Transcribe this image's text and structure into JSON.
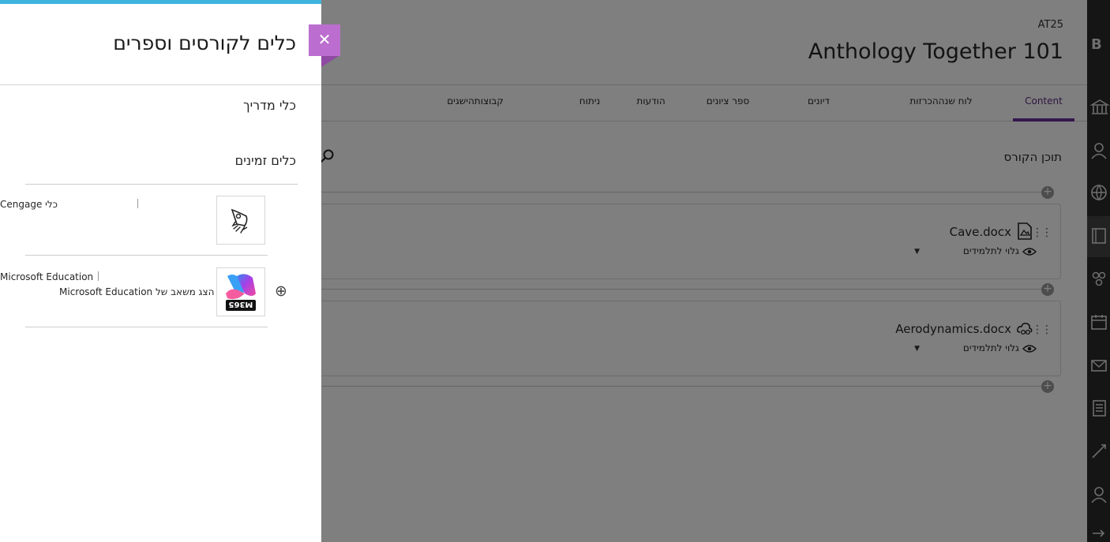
{
  "course": {
    "code": "AT25",
    "title": "Anthology Together 101",
    "tabs": [
      {
        "label": "Content",
        "active": true
      },
      {
        "label": "לוח שנההכרזות"
      },
      {
        "label": "דיונים"
      },
      {
        "label": "ספר ציונים"
      },
      {
        "label": "הודעות"
      },
      {
        "label": "ניתוח"
      },
      {
        "label": "קבוצותהישגים"
      }
    ],
    "content_heading": "תוכן הקורס",
    "items": [
      {
        "title": "Cave.docx",
        "visibility": "גלוי לתלמידים",
        "icon": "document-icon"
      },
      {
        "title": "Aerodynamics.docx",
        "visibility": "גלוי לתלמידים",
        "icon": "cloud-document-icon"
      }
    ]
  },
  "panel": {
    "title": "כלים לקורסים וספרים",
    "instructor_tools_label": "כלי מדריך",
    "available_tools_label": "כלים זמינים",
    "close_symbol": "✕",
    "tools": [
      {
        "name": "Cengage כלי",
        "icon": "rocket-icon"
      },
      {
        "name": "Microsoft Education",
        "description": "הצג משאב של Microsoft Education",
        "icon": "m365-icon",
        "add_symbol": "⊕"
      }
    ]
  },
  "colors": {
    "accent_purple": "#6b2f9a",
    "close_button": "#bb6ecf",
    "top_stripe": "#3fb4de",
    "rail": "#2b2b2b"
  }
}
